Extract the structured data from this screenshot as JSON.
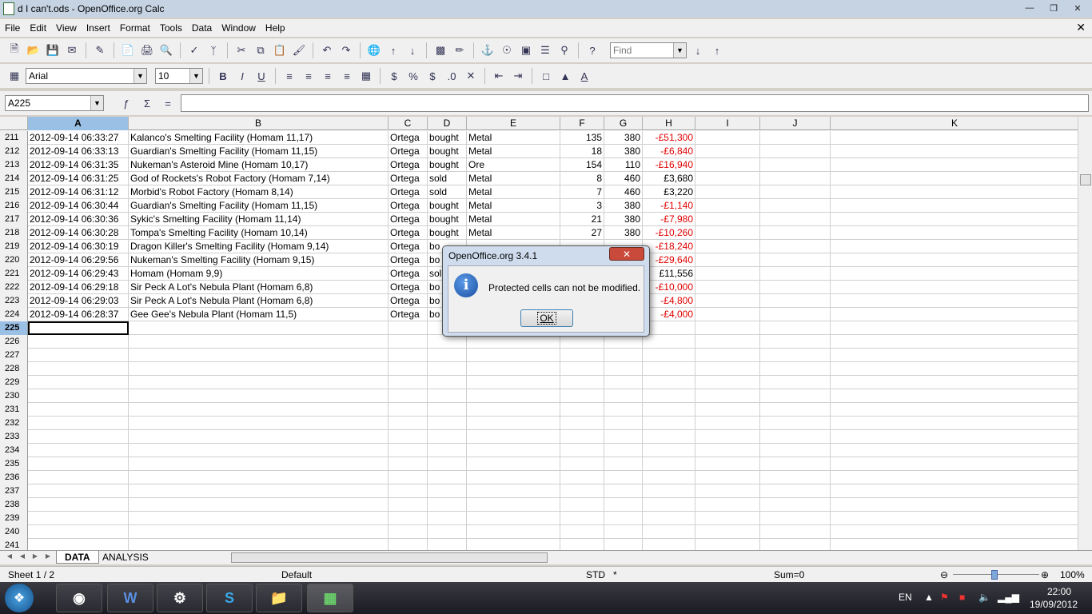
{
  "window": {
    "title": "d I can't.ods - OpenOffice.org Calc"
  },
  "menu": [
    "File",
    "Edit",
    "View",
    "Insert",
    "Format",
    "Tools",
    "Data",
    "Window",
    "Help"
  ],
  "toolbar": {
    "find_placeholder": "Find",
    "font_name": "Arial",
    "font_size": "10"
  },
  "formula": {
    "name_box": "A225",
    "input": ""
  },
  "columns": [
    "A",
    "B",
    "C",
    "D",
    "E",
    "F",
    "G",
    "H",
    "I",
    "J",
    "K"
  ],
  "rows": [
    {
      "n": "211",
      "a": "2012-09-14 06:33:27",
      "b": "Kalanco's Smelting Facility (Homam 11,17)",
      "c": "Ortega",
      "d": "bought",
      "e": "Metal",
      "f": "135",
      "g": "380",
      "h": "-£51,300"
    },
    {
      "n": "212",
      "a": "2012-09-14 06:33:13",
      "b": "Guardian's Smelting Facility (Homam 11,15)",
      "c": "Ortega",
      "d": "bought",
      "e": "Metal",
      "f": "18",
      "g": "380",
      "h": "-£6,840"
    },
    {
      "n": "213",
      "a": "2012-09-14 06:31:35",
      "b": "Nukeman's Asteroid Mine (Homam 10,17)",
      "c": "Ortega",
      "d": "bought",
      "e": "Ore",
      "f": "154",
      "g": "110",
      "h": "-£16,940"
    },
    {
      "n": "214",
      "a": "2012-09-14 06:31:25",
      "b": "God of Rockets's Robot Factory (Homam 7,14)",
      "c": "Ortega",
      "d": "sold",
      "e": "Metal",
      "f": "8",
      "g": "460",
      "h": "£3,680"
    },
    {
      "n": "215",
      "a": "2012-09-14 06:31:12",
      "b": "Morbid's Robot Factory (Homam 8,14)",
      "c": "Ortega",
      "d": "sold",
      "e": "Metal",
      "f": "7",
      "g": "460",
      "h": "£3,220"
    },
    {
      "n": "216",
      "a": "2012-09-14 06:30:44",
      "b": "Guardian's Smelting Facility (Homam 11,15)",
      "c": "Ortega",
      "d": "bought",
      "e": "Metal",
      "f": "3",
      "g": "380",
      "h": "-£1,140"
    },
    {
      "n": "217",
      "a": "2012-09-14 06:30:36",
      "b": "Sykic's Smelting Facility (Homam 11,14)",
      "c": "Ortega",
      "d": "bought",
      "e": "Metal",
      "f": "21",
      "g": "380",
      "h": "-£7,980"
    },
    {
      "n": "218",
      "a": "2012-09-14 06:30:28",
      "b": "Tompa's Smelting Facility (Homam 10,14)",
      "c": "Ortega",
      "d": "bought",
      "e": "Metal",
      "f": "27",
      "g": "380",
      "h": "-£10,260"
    },
    {
      "n": "219",
      "a": "2012-09-14 06:30:19",
      "b": "Dragon Killer's Smelting Facility (Homam 9,14)",
      "c": "Ortega",
      "d": "bo",
      "e": "",
      "f": "",
      "g": "",
      "h": "-£18,240"
    },
    {
      "n": "220",
      "a": "2012-09-14 06:29:56",
      "b": "Nukeman's Smelting Facility (Homam 9,15)",
      "c": "Ortega",
      "d": "bo",
      "e": "",
      "f": "",
      "g": "",
      "h": "-£29,640"
    },
    {
      "n": "221",
      "a": "2012-09-14 06:29:43",
      "b": "Homam (Homam 9,9)",
      "c": "Ortega",
      "d": "sol",
      "e": "",
      "f": "",
      "g": "",
      "h": "£11,556"
    },
    {
      "n": "222",
      "a": "2012-09-14 06:29:18",
      "b": "Sir Peck A Lot's Nebula Plant (Homam 6,8)",
      "c": "Ortega",
      "d": "bo",
      "e": "",
      "f": "",
      "g": "",
      "h": "-£10,000"
    },
    {
      "n": "223",
      "a": "2012-09-14 06:29:03",
      "b": "Sir Peck A Lot's Nebula Plant (Homam 6,8)",
      "c": "Ortega",
      "d": "bo",
      "e": "",
      "f": "",
      "g": "",
      "h": "-£4,800"
    },
    {
      "n": "224",
      "a": "2012-09-14 06:28:37",
      "b": "Gee Gee's Nebula Plant (Homam 11,5)",
      "c": "Ortega",
      "d": "bo",
      "e": "",
      "f": "",
      "g": "",
      "h": "-£4,000"
    },
    {
      "n": "225",
      "a": "",
      "b": "",
      "c": "",
      "d": "",
      "e": "",
      "f": "",
      "g": "",
      "h": ""
    },
    {
      "n": "226",
      "a": "",
      "b": "",
      "c": "",
      "d": "",
      "e": "",
      "f": "",
      "g": "",
      "h": ""
    },
    {
      "n": "227",
      "a": "",
      "b": "",
      "c": "",
      "d": "",
      "e": "",
      "f": "",
      "g": "",
      "h": ""
    },
    {
      "n": "228",
      "a": "",
      "b": "",
      "c": "",
      "d": "",
      "e": "",
      "f": "",
      "g": "",
      "h": ""
    },
    {
      "n": "229",
      "a": "",
      "b": "",
      "c": "",
      "d": "",
      "e": "",
      "f": "",
      "g": "",
      "h": ""
    },
    {
      "n": "230",
      "a": "",
      "b": "",
      "c": "",
      "d": "",
      "e": "",
      "f": "",
      "g": "",
      "h": ""
    },
    {
      "n": "231",
      "a": "",
      "b": "",
      "c": "",
      "d": "",
      "e": "",
      "f": "",
      "g": "",
      "h": ""
    },
    {
      "n": "232",
      "a": "",
      "b": "",
      "c": "",
      "d": "",
      "e": "",
      "f": "",
      "g": "",
      "h": ""
    },
    {
      "n": "233",
      "a": "",
      "b": "",
      "c": "",
      "d": "",
      "e": "",
      "f": "",
      "g": "",
      "h": ""
    },
    {
      "n": "234",
      "a": "",
      "b": "",
      "c": "",
      "d": "",
      "e": "",
      "f": "",
      "g": "",
      "h": ""
    },
    {
      "n": "235",
      "a": "",
      "b": "",
      "c": "",
      "d": "",
      "e": "",
      "f": "",
      "g": "",
      "h": ""
    },
    {
      "n": "236",
      "a": "",
      "b": "",
      "c": "",
      "d": "",
      "e": "",
      "f": "",
      "g": "",
      "h": ""
    },
    {
      "n": "237",
      "a": "",
      "b": "",
      "c": "",
      "d": "",
      "e": "",
      "f": "",
      "g": "",
      "h": ""
    },
    {
      "n": "238",
      "a": "",
      "b": "",
      "c": "",
      "d": "",
      "e": "",
      "f": "",
      "g": "",
      "h": ""
    },
    {
      "n": "239",
      "a": "",
      "b": "",
      "c": "",
      "d": "",
      "e": "",
      "f": "",
      "g": "",
      "h": ""
    },
    {
      "n": "240",
      "a": "",
      "b": "",
      "c": "",
      "d": "",
      "e": "",
      "f": "",
      "g": "",
      "h": ""
    },
    {
      "n": "241",
      "a": "",
      "b": "",
      "c": "",
      "d": "",
      "e": "",
      "f": "",
      "g": "",
      "h": ""
    }
  ],
  "sheets": {
    "tab1": "DATA",
    "tab2": "ANALYSIS"
  },
  "status": {
    "sheet": "Sheet 1 / 2",
    "style": "Default",
    "mode": "STD",
    "modified": "*",
    "sum": "Sum=0",
    "zoom": "100%"
  },
  "dialog": {
    "title": "OpenOffice.org 3.4.1",
    "message": "Protected cells can not be modified.",
    "ok": "OK",
    "close": "✕"
  },
  "tray": {
    "lang": "EN",
    "time": "22:00",
    "date": "19/09/2012"
  },
  "colors": {
    "negative": "#e00000",
    "selection": "#9bc0e6"
  }
}
